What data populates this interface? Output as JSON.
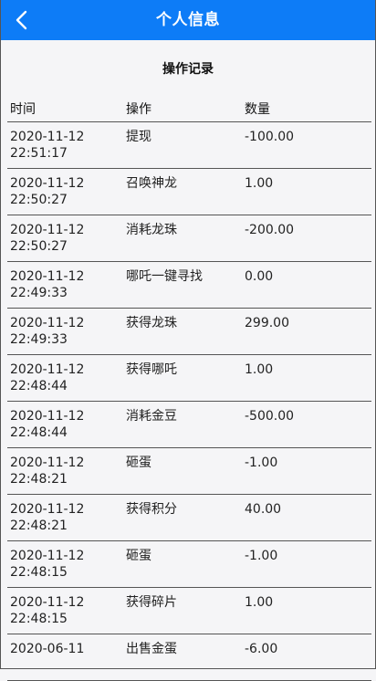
{
  "header": {
    "title": "个人信息",
    "back_icon": "chevron-left-icon",
    "bg_color": "#0d7cf7"
  },
  "section": {
    "title": "操作记录"
  },
  "table": {
    "headers": [
      "时间",
      "操作",
      "数量"
    ],
    "rows": [
      {
        "date": "2020-11-12",
        "time": "22:51:17",
        "op": "提现",
        "qty": "-100.00"
      },
      {
        "date": "2020-11-12",
        "time": "22:50:27",
        "op": "召唤神龙",
        "qty": "1.00"
      },
      {
        "date": "2020-11-12",
        "time": "22:50:27",
        "op": "消耗龙珠",
        "qty": "-200.00"
      },
      {
        "date": "2020-11-12",
        "time": "22:49:33",
        "op": "哪吒一键寻找",
        "qty": "0.00"
      },
      {
        "date": "2020-11-12",
        "time": "22:49:33",
        "op": "获得龙珠",
        "qty": "299.00"
      },
      {
        "date": "2020-11-12",
        "time": "22:48:44",
        "op": "获得哪吒",
        "qty": "1.00"
      },
      {
        "date": "2020-11-12",
        "time": "22:48:44",
        "op": "消耗金豆",
        "qty": "-500.00"
      },
      {
        "date": "2020-11-12",
        "time": "22:48:21",
        "op": "砸蛋",
        "qty": "-1.00"
      },
      {
        "date": "2020-11-12",
        "time": "22:48:21",
        "op": "获得积分",
        "qty": "40.00"
      },
      {
        "date": "2020-11-12",
        "time": "22:48:15",
        "op": "砸蛋",
        "qty": "-1.00"
      },
      {
        "date": "2020-11-12",
        "time": "22:48:15",
        "op": "获得碎片",
        "qty": "1.00"
      },
      {
        "date": "2020-06-11",
        "time": "",
        "op": "出售金蛋",
        "qty": "-6.00"
      }
    ]
  }
}
